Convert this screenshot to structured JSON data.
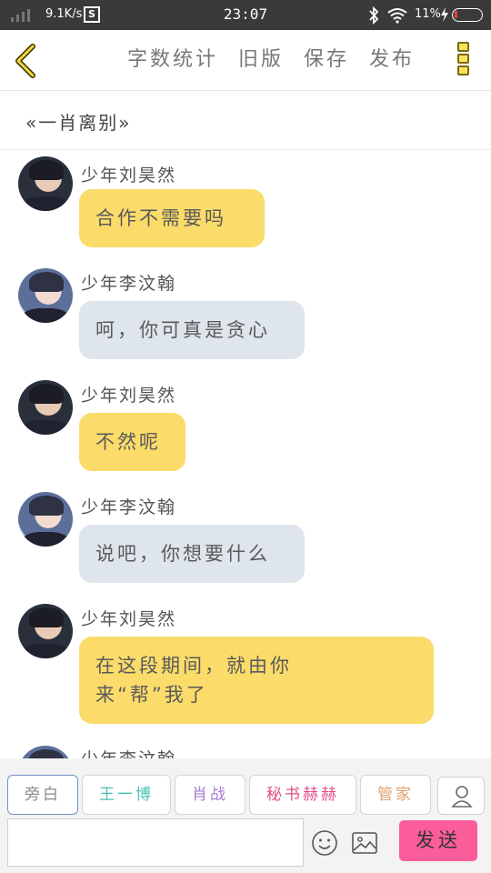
{
  "status_bar": {
    "speed": "9.1K/s",
    "sim_label": "S",
    "time": "23:07",
    "battery_text": "11%",
    "battery_level": 0.11,
    "icons": [
      "signal-icon",
      "bluetooth-icon",
      "wifi-icon",
      "charging-icon",
      "battery-icon"
    ]
  },
  "toolbar": {
    "back_icon": "back-chevron-icon",
    "items": [
      "字数统计",
      "旧版",
      "保存",
      "发布"
    ],
    "more_icon": "more-vertical-icon"
  },
  "title": "«一肖离别»",
  "messages": [
    {
      "sender": "少年刘昊然",
      "text": "合作不需要吗",
      "lines": [
        "合作不需要吗"
      ],
      "color": "yellow",
      "avatar": "avatar-liu"
    },
    {
      "sender": "少年李汶翰",
      "text": "呵，你可真是贪心",
      "lines": [
        "呵，你可真是贪心"
      ],
      "color": "gray",
      "avatar": "avatar-li"
    },
    {
      "sender": "少年刘昊然",
      "text": "不然呢",
      "lines": [
        "不然呢"
      ],
      "color": "yellow",
      "avatar": "avatar-liu"
    },
    {
      "sender": "少年李汶翰",
      "text": "说吧，你想要什么",
      "lines": [
        "说吧，你想要什么"
      ],
      "color": "gray",
      "avatar": "avatar-li"
    },
    {
      "sender": "少年刘昊然",
      "text": "在这段期间，就由你来“帮”我了",
      "lines": [
        "在这段期间，就由你",
        "来“帮”我了"
      ],
      "color": "yellow",
      "avatar": "avatar-liu"
    },
    {
      "sender": "少年李汶翰",
      "text": "",
      "lines": [],
      "color": "gray",
      "avatar": "avatar-li"
    }
  ],
  "roles": [
    {
      "label": "旁白",
      "color": "#8a8a8a",
      "selected": true
    },
    {
      "label": "王一博",
      "color": "#4cc0b0",
      "selected": false
    },
    {
      "label": "肖战",
      "color": "#a77ad6",
      "selected": false
    },
    {
      "label": "秘书赫赫",
      "color": "#e0508a",
      "selected": false
    },
    {
      "label": "管家",
      "color": "#e0a070",
      "selected": false
    }
  ],
  "composer": {
    "input_value": "",
    "placeholder": "",
    "send_label": "发送",
    "icons": [
      "emoji-icon",
      "image-icon",
      "add-role-icon"
    ]
  },
  "colors": {
    "bubble_yellow": "#fbdb6a",
    "bubble_gray": "#dee5ec",
    "send_button": "#fb5d9a",
    "status_bar": "#3a3a3a"
  }
}
